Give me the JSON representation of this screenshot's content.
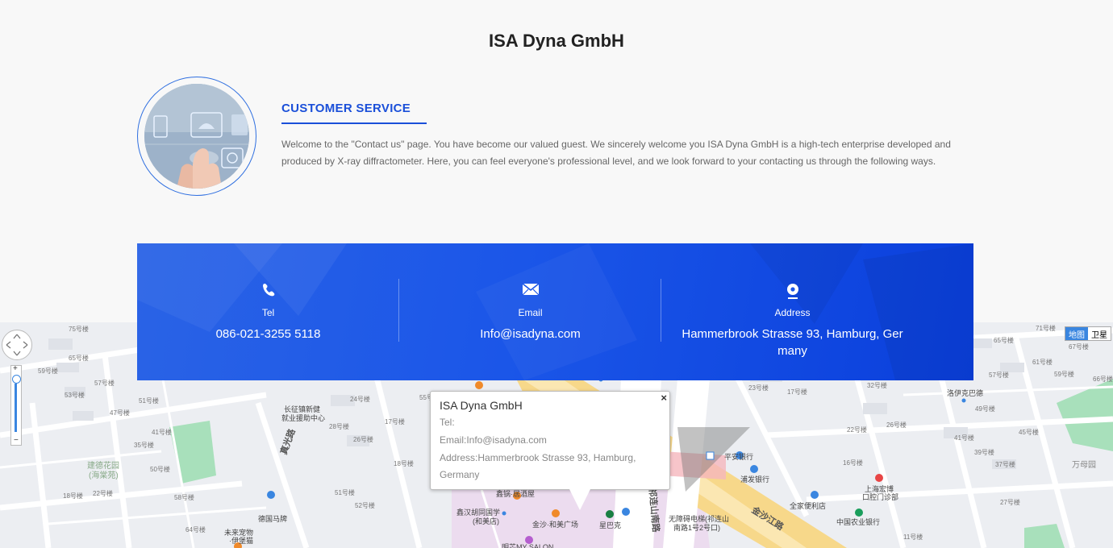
{
  "page": {
    "company_title": "ISA Dyna GmbH"
  },
  "customer_service": {
    "heading": "CUSTOMER SERVICE",
    "welcome_text": "Welcome to the \"Contact us\" page. You have become our valued guest. We sincerely welcome you ISA Dyna GmbH is a high-tech enterprise developed and produced by X-ray diffractometer. Here, you can feel everyone's professional level, and we look forward to your contacting us through the following ways."
  },
  "contact": {
    "tel": {
      "label": "Tel",
      "value": "086-021-3255 5118",
      "icon": "phone-icon"
    },
    "email": {
      "label": "Email",
      "value": "Info@isadyna.com",
      "icon": "envelope-icon"
    },
    "address": {
      "label": "Address",
      "value": "Hammerbrook Strasse 93, Hamburg, Germany",
      "icon": "location-pin-icon"
    }
  },
  "map": {
    "type_toggle": {
      "map": "地图",
      "satellite": "卫星"
    },
    "zoom_in": "+",
    "zoom_out": "−",
    "popup": {
      "title": "ISA Dyna GmbH",
      "tel": "Tel:",
      "email": "Email:Info@isadyna.com",
      "address_line1": "Address:Hammerbrook Strasse 93, Hamburg,",
      "address_line2": "Germany",
      "close": "×"
    },
    "labels": {
      "l1": "长征镇新健",
      "l2": "就业援助中心",
      "l3": "建德花园",
      "l4": "(海棠苑)",
      "l5": "德国马牌",
      "l6": "未来宠物",
      "l7": "·伊堡猫",
      "l8": "鑫锅·居酒屋",
      "l9": "鑫汉胡同国学",
      "l10": "(和美店)",
      "l11": "金沙·和美广场",
      "l12": "星巴克",
      "l13": "明芯MY SALON",
      "l14": "平安银行",
      "l15": "浦发银行",
      "l16": "无障碍电梯(祁连山",
      "l17": "南路1号2号口)",
      "l18": "全家便利店",
      "l19": "上海宏博",
      "l20": "口腔门诊部",
      "l21": "中国农业银行",
      "l22": "洛伊克巴德",
      "l23": "万母园",
      "l24": "金沙江路",
      "l25": "祁连山南路",
      "l26": "真光路",
      "b1": "75号楼",
      "b2": "65号楼",
      "b3": "59号楼",
      "b4": "57号楼",
      "b5": "53号楼",
      "b6": "51号楼",
      "b7": "47号楼",
      "b8": "41号楼",
      "b9": "35号楼",
      "b10": "50号楼",
      "b11": "58号楼",
      "b12": "22号楼",
      "b13": "18号楼",
      "b14": "64号楼",
      "b15": "24号楼",
      "b16": "28号楼",
      "b17": "26号楼",
      "b18": "17号楼",
      "b19": "18号楼",
      "b20": "51号楼",
      "b21": "52号楼",
      "b22": "55号楼",
      "b23": "23号楼",
      "b24": "17号楼",
      "b25": "32号楼",
      "b26": "26号楼",
      "b27": "22号楼",
      "b28": "16号楼",
      "b29": "71号楼",
      "b30": "67号楼",
      "b31": "61号楼",
      "b32": "59号楼",
      "b33": "57号楼",
      "b34": "49号楼",
      "b35": "45号楼",
      "b36": "41号楼",
      "b37": "39号楼",
      "b38": "37号楼",
      "b39": "27号楼",
      "b40": "11号楼",
      "b41": "65号楼",
      "b42": "66号楼"
    }
  }
}
